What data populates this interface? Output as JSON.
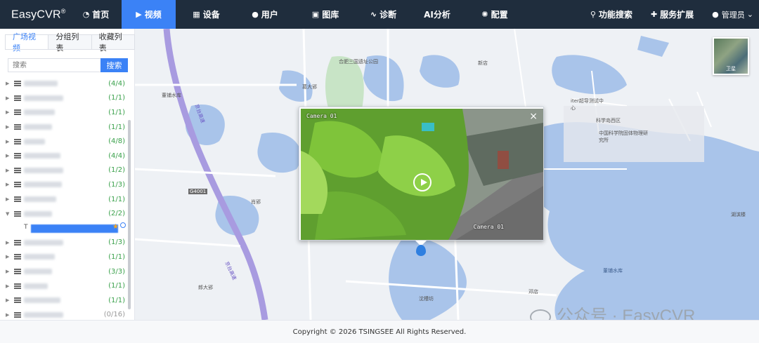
{
  "header": {
    "logo": "EasyCVR",
    "logo_mark": "®",
    "nav": [
      {
        "label": "首页",
        "icon": "dashboard-icon"
      },
      {
        "label": "视频",
        "icon": "play-icon",
        "active": true
      },
      {
        "label": "设备",
        "icon": "device-icon"
      },
      {
        "label": "用户",
        "icon": "user-icon"
      },
      {
        "label": "图库",
        "icon": "gallery-icon"
      },
      {
        "label": "诊断",
        "icon": "pulse-icon"
      },
      {
        "label": "AI分析",
        "icon": ""
      },
      {
        "label": "配置",
        "icon": "gear-icon"
      }
    ],
    "right": [
      {
        "label": "功能搜索",
        "icon": "search-icon"
      },
      {
        "label": "服务扩展",
        "icon": "puzzle-icon"
      }
    ],
    "admin": "管理员"
  },
  "sidebar": {
    "tabs": [
      "广场视频",
      "分组列表",
      "收藏列表"
    ],
    "search_placeholder": "搜索",
    "search_button": "搜索",
    "items": [
      {
        "count": "(4/4)"
      },
      {
        "count": "(1/1)"
      },
      {
        "count": "(1/1)"
      },
      {
        "count": "(1/1)"
      },
      {
        "count": "(4/8)"
      },
      {
        "count": "(4/4)"
      },
      {
        "count": "(1/2)"
      },
      {
        "count": "(1/3)"
      },
      {
        "count": "(1/1)"
      },
      {
        "count": "(2/2)",
        "expanded": true
      },
      {
        "count": "(1/3)"
      },
      {
        "count": "(1/1)"
      },
      {
        "count": "(3/3)"
      },
      {
        "count": "(1/1)"
      },
      {
        "count": "(1/1)"
      },
      {
        "count": "(0/16)"
      }
    ]
  },
  "map": {
    "labels": [
      {
        "text": "合肥三国遗址公园"
      },
      {
        "text": "葛大郢"
      },
      {
        "text": "新店"
      },
      {
        "text": "董铺水库"
      },
      {
        "text": "iter超导测试中心"
      },
      {
        "text": "科学岛西区"
      },
      {
        "text": "中国科学院固体物理研究所"
      },
      {
        "text": "肖郢"
      },
      {
        "text": "湖滨楼"
      },
      {
        "text": "郎大郢"
      },
      {
        "text": "沈槽坊"
      },
      {
        "text": "邓店"
      },
      {
        "text": "董铺水库"
      },
      {
        "text": "G4001"
      },
      {
        "text": "京台高速"
      },
      {
        "text": "京台高速"
      }
    ],
    "satellite_label": "卫星",
    "video": {
      "title": "Camera 01",
      "osd_bottom": "Camera 01",
      "close": "×"
    }
  },
  "watermark": "公众号 · EasyCVR",
  "footer": "Copyright © 2026 TSINGSEE All Rights Reserved."
}
